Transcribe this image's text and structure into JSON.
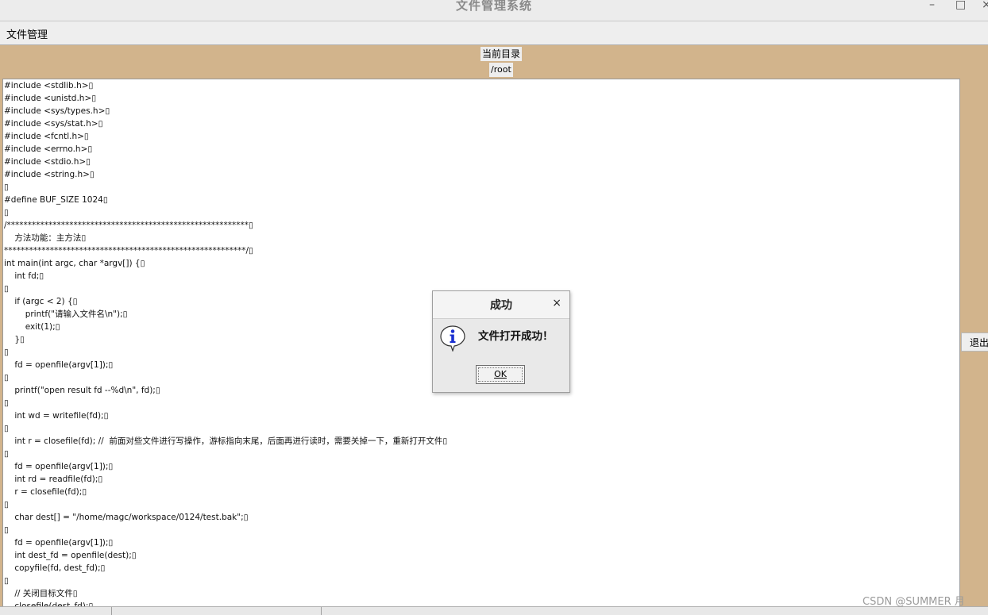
{
  "window": {
    "title": "文件管理系统",
    "minimize_glyph": "–",
    "maximize_glyph": "□",
    "close_glyph": "×"
  },
  "menu": {
    "items": [
      "文件管理"
    ]
  },
  "directory": {
    "label": "当前目录",
    "path": "/root"
  },
  "editor": {
    "lines": [
      "#include <stdlib.h>▯",
      "#include <unistd.h>▯",
      "#include <sys/types.h>▯",
      "#include <sys/stat.h>▯",
      "#include <fcntl.h>▯",
      "#include <errno.h>▯",
      "#include <stdio.h>▯",
      "#include <string.h>▯",
      "▯",
      "#define BUF_SIZE 1024▯",
      "▯",
      "/**********************************************************▯",
      "    方法功能：主方法▯",
      "**********************************************************/▯",
      "int main(int argc, char *argv[]) {▯",
      "    int fd;▯",
      "▯",
      "    if (argc < 2) {▯",
      "        printf(\"请输入文件名\\n\");▯",
      "        exit(1);▯",
      "    }▯",
      "▯",
      "    fd = openfile(argv[1]);▯",
      "▯",
      "    printf(\"open result fd --%d\\n\", fd);▯",
      "▯",
      "    int wd = writefile(fd);▯",
      "▯",
      "    int r = closefile(fd); //  前面对些文件进行写操作，游标指向末尾，后面再进行读时，需要关掉一下，重新打开文件▯",
      "▯",
      "    fd = openfile(argv[1]);▯",
      "    int rd = readfile(fd);▯",
      "    r = closefile(fd);▯",
      "▯",
      "    char dest[] = \"/home/magc/workspace/0124/test.bak\";▯",
      "▯",
      "    fd = openfile(argv[1]);▯",
      "    int dest_fd = openfile(dest);▯",
      "    copyfile(fd, dest_fd);▯",
      "▯",
      "    // 关闭目标文件▯",
      "    closefile(dest_fd);▯"
    ]
  },
  "side": {
    "exit_label": "退出"
  },
  "dialog": {
    "title": "成功",
    "close_glyph": "×",
    "message": "文件打开成功！",
    "ok_label": "OK",
    "icon": "info-icon"
  },
  "watermark": "CSDN @SUMMER 月",
  "colors": {
    "background": "#d2b48c",
    "editor_bg": "#ffffff",
    "info_icon": "#1a2fd0"
  }
}
